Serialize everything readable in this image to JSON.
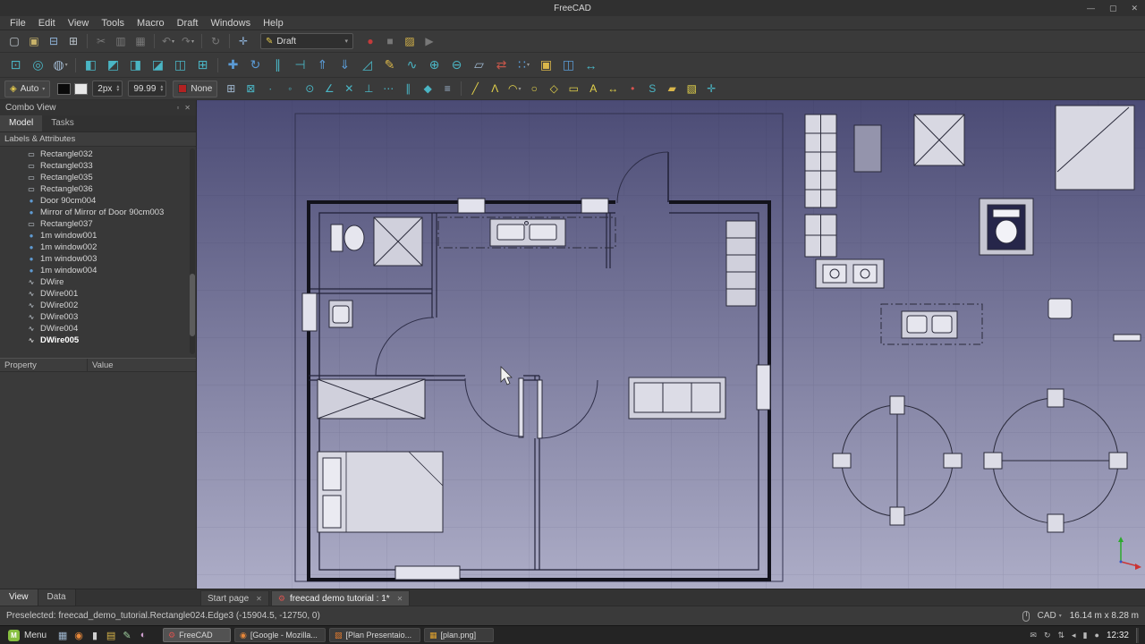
{
  "titlebar": {
    "title": "FreeCAD",
    "minimize": "—",
    "maximize": "▢",
    "close": "✕"
  },
  "menubar": {
    "items": [
      "File",
      "Edit",
      "View",
      "Tools",
      "Macro",
      "Draft",
      "Windows",
      "Help"
    ]
  },
  "toolbar_file": {
    "icons": [
      {
        "name": "new-document-icon",
        "glyph": "▢",
        "color": "#c9d2da"
      },
      {
        "name": "open-document-icon",
        "glyph": "▣",
        "color": "#c9b36a"
      },
      {
        "name": "save-icon",
        "glyph": "⊟",
        "color": "#8fb3d9"
      },
      {
        "name": "print-icon",
        "glyph": "⊞",
        "color": "#b9c2ca"
      },
      {
        "sep": true
      },
      {
        "name": "cut-icon",
        "glyph": "✂",
        "color": "#787878"
      },
      {
        "name": "copy-icon",
        "glyph": "▥",
        "color": "#787878"
      },
      {
        "name": "paste-icon",
        "glyph": "▦",
        "color": "#787878"
      },
      {
        "sep": true
      },
      {
        "name": "undo-icon",
        "glyph": "↶",
        "color": "#787878",
        "dropdown": true
      },
      {
        "name": "redo-icon",
        "glyph": "↷",
        "color": "#787878",
        "dropdown": true
      },
      {
        "sep": true
      },
      {
        "name": "refresh-icon",
        "glyph": "↻",
        "color": "#787878"
      },
      {
        "sep": true
      },
      {
        "name": "link-navigate-icon",
        "glyph": "✛",
        "color": "#8fb3d9"
      }
    ],
    "workbench": {
      "icon": "✎",
      "icon_color": "#e3c94d",
      "label": "Draft",
      "caret": "▾"
    },
    "macro_icons": [
      {
        "name": "macro-record-icon",
        "glyph": "●",
        "color": "#c43b3b"
      },
      {
        "name": "macro-stop-icon",
        "glyph": "■",
        "color": "#787878"
      },
      {
        "name": "macro-dialog-icon",
        "glyph": "▨",
        "color": "#d9b64a"
      },
      {
        "name": "macro-play-icon",
        "glyph": "▶",
        "color": "#787878"
      }
    ]
  },
  "toolbar_modify": {
    "icons": [
      {
        "name": "fit-all-icon",
        "glyph": "⊡",
        "color": "#4ab5c4"
      },
      {
        "name": "fit-selection-icon",
        "glyph": "◎",
        "color": "#4ab5c4"
      },
      {
        "name": "draw-style-icon",
        "glyph": "◍",
        "color": "#9fb7cf",
        "dropdown": true
      },
      {
        "sep": true
      },
      {
        "name": "view-front-icon",
        "glyph": "◧",
        "color": "#4ab5c4"
      },
      {
        "name": "view-top-icon",
        "glyph": "◩",
        "color": "#4ab5c4"
      },
      {
        "name": "view-right-icon",
        "glyph": "◨",
        "color": "#4ab5c4"
      },
      {
        "name": "view-rear-icon",
        "glyph": "◪",
        "color": "#4ab5c4"
      },
      {
        "name": "view-bottom-icon",
        "glyph": "◫",
        "color": "#4ab5c4"
      },
      {
        "name": "view-axonometric-icon",
        "glyph": "⊞",
        "color": "#4ab5c4"
      },
      {
        "sep": true
      },
      {
        "name": "move-icon",
        "glyph": "✚",
        "color": "#5b9bd5"
      },
      {
        "name": "rotate-icon",
        "glyph": "↻",
        "color": "#5b9bd5"
      },
      {
        "name": "offset-icon",
        "glyph": "∥",
        "color": "#4ab5c4"
      },
      {
        "name": "trim-icon",
        "glyph": "⊣",
        "color": "#4ab5c4"
      },
      {
        "name": "upgrade-icon",
        "glyph": "⇑",
        "color": "#5b9bd5"
      },
      {
        "name": "downgrade-icon",
        "glyph": "⇓",
        "color": "#5b9bd5"
      },
      {
        "name": "scale-icon",
        "glyph": "◿",
        "color": "#4ab5c4"
      },
      {
        "name": "edit-icon",
        "glyph": "✎",
        "color": "#d9b64a"
      },
      {
        "name": "wire-to-bspline-icon",
        "glyph": "∿",
        "color": "#4ab5c4"
      },
      {
        "name": "add-point-icon",
        "glyph": "⊕",
        "color": "#4ab5c4"
      },
      {
        "name": "remove-point-icon",
        "glyph": "⊖",
        "color": "#4ab5c4"
      },
      {
        "name": "shape-2d-view-icon",
        "glyph": "▱",
        "color": "#9fb7cf"
      },
      {
        "name": "draft-to-sketch-icon",
        "glyph": "⇄",
        "color": "#c4564a"
      },
      {
        "name": "array-icon",
        "glyph": "∷",
        "color": "#5b9bd5",
        "dropdown": true
      },
      {
        "name": "clone-icon",
        "glyph": "▣",
        "color": "#d9b64a"
      },
      {
        "name": "mirror-icon",
        "glyph": "◫",
        "color": "#5b9bd5"
      },
      {
        "name": "stretch-icon",
        "glyph": "↔",
        "color": "#4ab5c4"
      }
    ]
  },
  "toolbar_draft": {
    "auto": {
      "icon": "◈",
      "icon_color": "#e3c94d",
      "label": "Auto",
      "caret": "▾"
    },
    "line_swatch": "#0a0a0a",
    "face_swatch": "#e8e8e8",
    "width_value": "2px",
    "size_value": "99.99",
    "fill_swatch": "#b22222",
    "fill_label": "None",
    "snap_icons": [
      {
        "name": "toggle-grid-icon",
        "glyph": "⊞",
        "color": "#9fb7cf"
      },
      {
        "name": "snap-lock-icon",
        "glyph": "⊠",
        "color": "#4ab5c4"
      },
      {
        "name": "snap-endpoint-icon",
        "glyph": "∙",
        "color": "#4ab5c4"
      },
      {
        "name": "snap-midpoint-icon",
        "glyph": "◦",
        "color": "#4ab5c4"
      },
      {
        "name": "snap-center-icon",
        "glyph": "⊙",
        "color": "#4ab5c4"
      },
      {
        "name": "snap-angle-icon",
        "glyph": "∠",
        "color": "#4ab5c4"
      },
      {
        "name": "snap-intersection-icon",
        "glyph": "✕",
        "color": "#4ab5c4"
      },
      {
        "name": "snap-perpendicular-icon",
        "glyph": "⊥",
        "color": "#4ab5c4"
      },
      {
        "name": "snap-extension-icon",
        "glyph": "⋯",
        "color": "#4ab5c4"
      },
      {
        "name": "snap-parallel-icon",
        "glyph": "∥",
        "color": "#4ab5c4"
      },
      {
        "name": "snap-special-icon",
        "glyph": "◆",
        "color": "#4ab5c4"
      },
      {
        "name": "snap-near-icon",
        "glyph": "≡",
        "color": "#9fb7cf"
      }
    ],
    "tool_icons": [
      {
        "name": "line-icon",
        "glyph": "╱",
        "color": "#e3d24b"
      },
      {
        "name": "polyline-icon",
        "glyph": "Λ",
        "color": "#e3d24b"
      },
      {
        "name": "arc-icon",
        "glyph": "◠",
        "color": "#e3d24b",
        "dropdown": true
      },
      {
        "name": "circle-icon",
        "glyph": "○",
        "color": "#e3d24b"
      },
      {
        "name": "polygon-icon",
        "glyph": "◇",
        "color": "#e3d24b"
      },
      {
        "name": "rectangle-icon",
        "glyph": "▭",
        "color": "#e3d24b"
      },
      {
        "name": "text-icon",
        "glyph": "A",
        "color": "#e3d24b"
      },
      {
        "name": "dimension-icon",
        "glyph": "↔",
        "color": "#e3d24b"
      },
      {
        "name": "point-icon",
        "glyph": "•",
        "color": "#d9534f"
      },
      {
        "name": "bspline-icon",
        "glyph": "S",
        "color": "#4ab5c4"
      },
      {
        "name": "facebinder-icon",
        "glyph": "▰",
        "color": "#d9b64a"
      },
      {
        "name": "hatch-icon",
        "glyph": "▧",
        "color": "#e3d24b"
      },
      {
        "name": "working-plane-icon",
        "glyph": "✛",
        "color": "#4ab5c4"
      }
    ]
  },
  "combo_view": {
    "title": "Combo View",
    "float_icon": "▫",
    "close_icon": "✕",
    "tabs": [
      {
        "label": "Model",
        "active": true
      },
      {
        "label": "Tasks",
        "active": false
      }
    ],
    "tree_header": "Labels & Attributes",
    "tree_items": [
      {
        "icon_glyph": "▭",
        "icon_color": "#cdd5dd",
        "label": "Rectangle032"
      },
      {
        "icon_glyph": "▭",
        "icon_color": "#cdd5dd",
        "label": "Rectangle033"
      },
      {
        "icon_glyph": "▭",
        "icon_color": "#cdd5dd",
        "label": "Rectangle035"
      },
      {
        "icon_glyph": "▭",
        "icon_color": "#cdd5dd",
        "label": "Rectangle036"
      },
      {
        "icon_glyph": "●",
        "icon_color": "#5f9bd3",
        "label": "Door 90cm004"
      },
      {
        "icon_glyph": "●",
        "icon_color": "#5f9bd3",
        "label": "Mirror of Mirror of Door 90cm003"
      },
      {
        "icon_glyph": "▭",
        "icon_color": "#cdd5dd",
        "label": "Rectangle037"
      },
      {
        "icon_glyph": "●",
        "icon_color": "#5f9bd3",
        "label": "1m window001"
      },
      {
        "icon_glyph": "●",
        "icon_color": "#5f9bd3",
        "label": "1m window002"
      },
      {
        "icon_glyph": "●",
        "icon_color": "#5f9bd3",
        "label": "1m window003"
      },
      {
        "icon_glyph": "●",
        "icon_color": "#5f9bd3",
        "label": "1m window004"
      },
      {
        "icon_glyph": "∿",
        "icon_color": "#cdd5dd",
        "label": "DWire"
      },
      {
        "icon_glyph": "∿",
        "icon_color": "#cdd5dd",
        "label": "DWire001"
      },
      {
        "icon_glyph": "∿",
        "icon_color": "#cdd5dd",
        "label": "DWire002"
      },
      {
        "icon_glyph": "∿",
        "icon_color": "#cdd5dd",
        "label": "DWire003"
      },
      {
        "icon_glyph": "∿",
        "icon_color": "#cdd5dd",
        "label": "DWire004"
      },
      {
        "icon_glyph": "∿",
        "icon_color": "#ffffff",
        "label": "DWire005",
        "bold": true
      }
    ],
    "property_header": {
      "property": "Property",
      "value": "Value"
    },
    "bottom_tabs": [
      {
        "label": "View",
        "active": true
      },
      {
        "label": "Data",
        "active": false
      }
    ]
  },
  "doc_tabs": [
    {
      "label": "Start page",
      "close": "✕"
    },
    {
      "icon_glyph": "⚙",
      "icon_color": "#d9534f",
      "label": "freecad demo tutorial : 1*",
      "close": "✕",
      "active": true
    }
  ],
  "statusbar": {
    "message": "Preselected: freecad_demo_tutorial.Rectangle024.Edge3 (-15904.5, -12750, 0)",
    "nav_style": "CAD",
    "nav_caret": "▾",
    "dimensions": "16.14 m x 8.28 m"
  },
  "taskbar": {
    "menu_label": "Menu",
    "launchers": [
      {
        "name": "show-desktop-icon",
        "glyph": "▦",
        "color": "#9fb7cf"
      },
      {
        "name": "browser-icon",
        "glyph": "◉",
        "color": "#e8883a"
      },
      {
        "name": "terminal-icon",
        "glyph": "▮",
        "color": "#cfcfcf"
      },
      {
        "name": "files-icon",
        "glyph": "▤",
        "color": "#d9b64a"
      },
      {
        "name": "text-editor-icon",
        "glyph": "✎",
        "color": "#9fcf9f"
      },
      {
        "name": "media-icon",
        "glyph": "◐",
        "color": "#cf9fcf"
      }
    ],
    "windows": [
      {
        "name": "task-freecad",
        "icon_glyph": "⚙",
        "icon_color": "#d9534f",
        "label": "FreeCAD",
        "active": true
      },
      {
        "name": "task-firefox",
        "icon_glyph": "◉",
        "icon_color": "#e8883a",
        "label": "[Google - Mozilla..."
      },
      {
        "name": "task-impress",
        "icon_glyph": "▨",
        "icon_color": "#e07a2e",
        "label": "[Plan Presentaio..."
      },
      {
        "name": "task-image",
        "icon_glyph": "▦",
        "icon_color": "#e0a22e",
        "label": "[plan.png]"
      }
    ],
    "tray": [
      {
        "name": "tray-mail-icon",
        "glyph": "✉"
      },
      {
        "name": "tray-update-icon",
        "glyph": "↻"
      },
      {
        "name": "tray-network-icon",
        "glyph": "⇅"
      },
      {
        "name": "tray-volume-icon",
        "glyph": "◂"
      },
      {
        "name": "tray-battery-icon",
        "glyph": "▮"
      },
      {
        "name": "tray-user-icon",
        "glyph": "●"
      }
    ],
    "clock": "12:32"
  }
}
